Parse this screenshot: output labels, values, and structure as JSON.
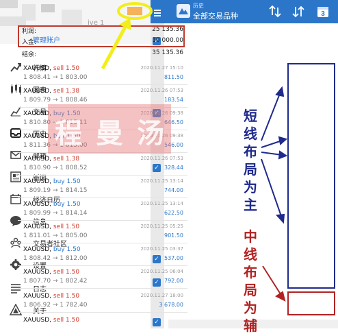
{
  "drawer": {
    "account_suffix": "ive 1",
    "manage_label": "管理账户",
    "items": [
      {
        "label": "行情",
        "icon": "trend-icon"
      },
      {
        "label": "图表",
        "icon": "candles-icon"
      },
      {
        "label": "交易",
        "icon": "trade-icon"
      },
      {
        "label": "历史",
        "icon": "inbox-icon"
      },
      {
        "label": "邮箱",
        "icon": "mail-icon"
      },
      {
        "label": "新闻",
        "icon": "news-icon"
      },
      {
        "label": "经济日历",
        "icon": "calendar-icon"
      },
      {
        "label": "信息",
        "icon": "chat-icon"
      },
      {
        "label": "交易者社区",
        "icon": "community-icon"
      },
      {
        "label": "设置",
        "icon": "gear-icon"
      },
      {
        "label": "日志",
        "icon": "log-icon"
      },
      {
        "label": "关于",
        "icon": "about-icon"
      }
    ]
  },
  "topbar": {
    "small_label": "历史",
    "title": "全部交易品种",
    "calendar_day": "3"
  },
  "summary": {
    "profit_label": "利润:",
    "profit_value": "25 135.36",
    "deposit_label": "入金:",
    "deposit_value": "10 000.00",
    "balance_label": "结余:",
    "balance_value": "35 135.36"
  },
  "deals": [
    {
      "symbol": "XAUUSD,",
      "side": "sell",
      "lots": "1.50",
      "prices": "1 808.41 → 1 803.00",
      "time": "2020.11.27 15:10",
      "profit": "811.50"
    },
    {
      "symbol": "XAUUSD,",
      "side": "sell",
      "lots": "1.38",
      "prices": "1 809.79 → 1 808.46",
      "time": "2020.11.26 07:53",
      "profit": "183.54"
    },
    {
      "symbol": "XAUUSD,",
      "side": "buy",
      "lots": "1.50",
      "prices": "1 810.80 → 1 815.11",
      "time": "2020.11.26 09:38",
      "profit": "646.50"
    },
    {
      "symbol": "XAUUSD,",
      "side": "buy",
      "lots": "1.50",
      "prices": "1 811.36 → 1 815.00",
      "time": "2020.11.26 09:38",
      "profit": "546.00"
    },
    {
      "symbol": "XAUUSD,",
      "side": "sell",
      "lots": "1.38",
      "prices": "1 810.90 → 1 808.52",
      "time": "2020.11.26 07:53",
      "profit": "328.44"
    },
    {
      "symbol": "XAUUSD,",
      "side": "buy",
      "lots": "1.50",
      "prices": "1 809.19 → 1 814.15",
      "time": "2020.11.25 13:14",
      "profit": "744.00"
    },
    {
      "symbol": "XAUUSD,",
      "side": "buy",
      "lots": "1.50",
      "prices": "1 809.99 → 1 814.14",
      "time": "2020.11.25 13:14",
      "profit": "622.50"
    },
    {
      "symbol": "XAUUSD,",
      "side": "sell",
      "lots": "1.50",
      "prices": "1 811.01 → 1 805.00",
      "time": "2020.11.25 05:25",
      "profit": "901.50"
    },
    {
      "symbol": "XAUUSD,",
      "side": "buy",
      "lots": "1.50",
      "prices": "1 808.42 → 1 812.00",
      "time": "2020.11.25 03:37",
      "profit": "537.00"
    },
    {
      "symbol": "XAUUSD,",
      "side": "sell",
      "lots": "1.50",
      "prices": "1 807.70 → 1 802.42",
      "time": "2020.11.25 06:04",
      "profit": "792.00"
    },
    {
      "symbol": "XAUUSD,",
      "side": "sell",
      "lots": "1.50",
      "prices": "1 806.92 → 1 782.40",
      "time": "2020.11.27 18:00",
      "profit": "3 678.00"
    },
    {
      "symbol": "XAUUSD,",
      "side": "sell",
      "lots": "1.50",
      "prices": "",
      "time": "",
      "profit": ""
    }
  ],
  "annotations": {
    "short": [
      "短",
      "线",
      "布",
      "局",
      "为",
      "主"
    ],
    "medium": [
      "中",
      "线",
      "布",
      "局",
      "为",
      "辅"
    ]
  },
  "watermark": [
    "程",
    "曼",
    "汤"
  ],
  "colors": {
    "brand_blue": "#2b76c9",
    "sell_red": "#d13b2b",
    "annot_blue": "#1f2a8c",
    "annot_red": "#b22222",
    "highlight_yellow": "#f2ee1a"
  }
}
